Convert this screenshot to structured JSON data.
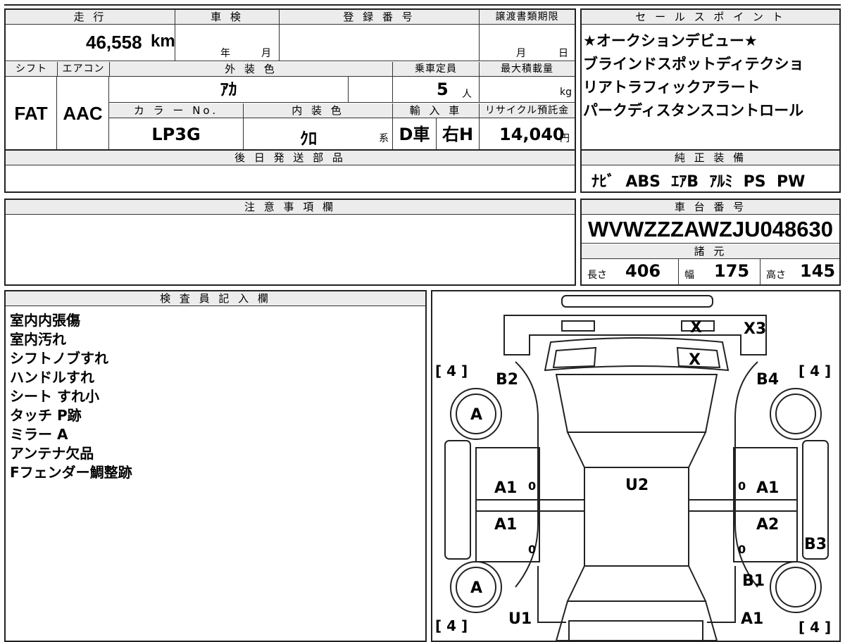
{
  "spec": {
    "mileage_header": "走 行",
    "mileage_value": "46,558",
    "mileage_unit": "km",
    "shaken_header": "車 検",
    "shaken_year": "年",
    "shaken_month": "月",
    "reg_header": "登 録 番 号",
    "transfer_header": "譲渡書類期限",
    "transfer_month": "月",
    "transfer_day": "日",
    "shift_header": "シフト",
    "shift_value": "FAT",
    "ac_header": "エアコン",
    "ac_value": "AAC",
    "exterior_header": "外 装 色",
    "exterior_value": "ｱｶ",
    "capacity_header": "乗車定員",
    "capacity_value": "5",
    "capacity_unit": "人",
    "load_header": "最大積載量",
    "load_unit": "kg",
    "color_no_header": "カ ラ ー No.",
    "color_no_value": "LP3G",
    "interior_header": "内 装 色",
    "interior_value": "ｸﾛ",
    "interior_suffix": "系",
    "import_header": "輸 入 車",
    "import_value": "D車",
    "handle_value": "右H",
    "recycle_header": "リサイクル預託金",
    "recycle_value": "14,040",
    "recycle_unit": "円",
    "later_parts_header": "後 日 発 送 部 品"
  },
  "sales_points": {
    "header": "セ ー ル ス ポ イ ン ト",
    "lines": [
      "★オークションデビュー★",
      "ブラインドスポットディテクショ",
      "リアトラフィックアラート",
      "パークディスタンスコントロール"
    ]
  },
  "equipment": {
    "header": "純 正 装 備",
    "value": "ﾅﾋﾞ  ABS  ｴｱB  ｱﾙﾐ  PS  PW"
  },
  "caution": {
    "header": "注 意 事 項 欄"
  },
  "chassis": {
    "header": "車 台 番 号",
    "value": "WVWZZZAWZJU048630",
    "dims_header": "諸 元",
    "length_label": "長さ",
    "length_value": "406",
    "width_label": "幅",
    "width_value": "175",
    "height_label": "高さ",
    "height_value": "145"
  },
  "inspector": {
    "header": "検 査 員 記 入 欄",
    "notes": [
      "室内内張傷",
      "室内汚れ",
      "シフトノブすれ",
      "ハンドルすれ",
      "シート すれ小",
      "タッチ P跡",
      "ミラー A",
      "アンテナ欠品",
      "Fフェンダー鯛整跡"
    ]
  },
  "diagram": {
    "marks": [
      "X3",
      "X",
      "X",
      "B2",
      "B4",
      "A",
      "A",
      "U2",
      "A1",
      "A1",
      "A1",
      "A2",
      "B3",
      "B1",
      "U1",
      "A1"
    ],
    "tire_left_top": "[ 4 ]",
    "tire_right_top": "[ 4 ]",
    "tire_left_bottom": "[ 4 ]",
    "tire_right_bottom": "[ 4 ]",
    "zero_marks": [
      "0",
      "0",
      "0",
      "0"
    ]
  }
}
